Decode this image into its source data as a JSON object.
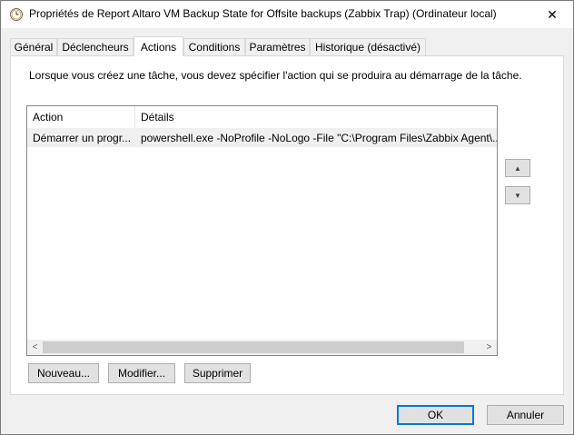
{
  "window": {
    "title": "Propriétés de Report Altaro VM Backup State for Offsite backups (Zabbix Trap) (Ordinateur local)",
    "close_glyph": "✕",
    "icon": "task-scheduler-clock-icon"
  },
  "tabs": [
    {
      "label": "Général",
      "active": false
    },
    {
      "label": "Déclencheurs",
      "active": false
    },
    {
      "label": "Actions",
      "active": true
    },
    {
      "label": "Conditions",
      "active": false
    },
    {
      "label": "Paramètres",
      "active": false
    },
    {
      "label": "Historique (désactivé)",
      "active": false
    }
  ],
  "actions_tab": {
    "intro": "Lorsque vous créez une tâche, vous devez spécifier l'action qui se produira au démarrage de la tâche.",
    "columns": [
      "Action",
      "Détails"
    ],
    "rows": [
      {
        "action": "Démarrer un progr...",
        "details": "powershell.exe -NoProfile -NoLogo -File \"C:\\Program Files\\Zabbix Agent\\..."
      }
    ],
    "move_up_glyph": "▲",
    "move_down_glyph": "▼",
    "scroll_left_glyph": "<",
    "scroll_right_glyph": ">",
    "new_label": "Nouveau...",
    "edit_label": "Modifier...",
    "delete_label": "Supprimer"
  },
  "footer": {
    "ok_label": "OK",
    "cancel_label": "Annuler"
  },
  "colors": {
    "window_bg": "#f0f0f0",
    "default_button_border": "#0078d7",
    "selected_row_bg": "#f0f0f0"
  }
}
